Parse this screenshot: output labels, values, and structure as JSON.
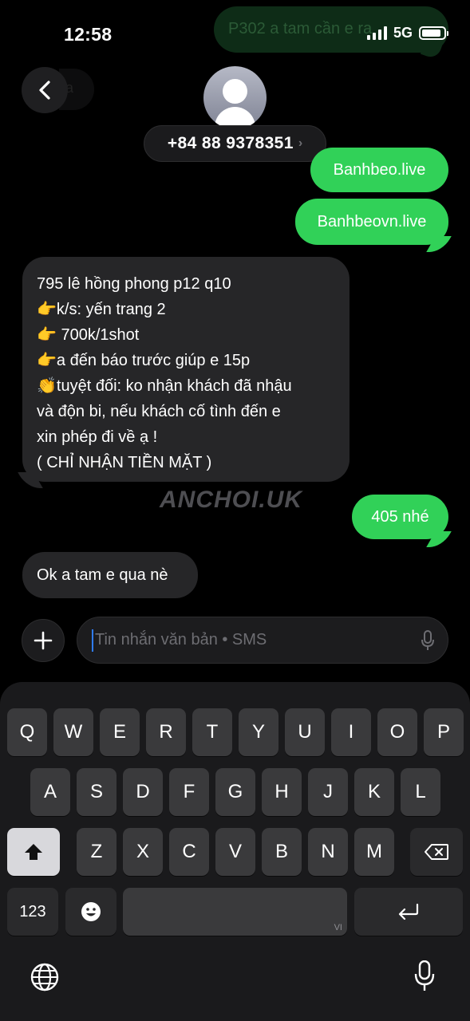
{
  "status": {
    "time": "12:58",
    "network": "5G"
  },
  "ghost_notification": {
    "text": "P302 a tam cần e ra"
  },
  "header": {
    "back_ghost_text": "a",
    "contact_number": "+84 88 9378351",
    "chevron": "›"
  },
  "messages": [
    {
      "direction": "outgoing",
      "text": "Banhbeo.live"
    },
    {
      "direction": "outgoing",
      "text": "Banhbeovn.live"
    },
    {
      "direction": "incoming",
      "lines": [
        "795 lê hồng phong p12 q10",
        "👉k/s: yến trang 2",
        "👉 700k/1shot",
        "👉a đến báo trước giúp e 15p",
        "👏tuyệt đối: ko nhận khách đã nhậu",
        "và độn bi, nếu khách cố tình đến e",
        "xin phép đi về ạ !",
        "( CHỈ NHẬN TIỀN MẶT )"
      ]
    },
    {
      "direction": "outgoing",
      "text": "405 nhé"
    },
    {
      "direction": "incoming",
      "text": "Ok a tam e qua nè"
    }
  ],
  "watermark": "ANCHOI.UK",
  "composer": {
    "placeholder": "Tin nhắn văn bản • SMS"
  },
  "keyboard": {
    "row1": [
      "Q",
      "W",
      "E",
      "R",
      "T",
      "Y",
      "U",
      "I",
      "O",
      "P"
    ],
    "row2": [
      "A",
      "S",
      "D",
      "F",
      "G",
      "H",
      "J",
      "K",
      "L"
    ],
    "row3": [
      "Z",
      "X",
      "C",
      "V",
      "B",
      "N",
      "M"
    ],
    "numbers_key": "123",
    "space_language": "VI"
  },
  "colors": {
    "outgoing_bubble": "#31d158",
    "incoming_bubble": "#262628",
    "caret": "#2f7cf6"
  },
  "icons": [
    "back-chevron-icon",
    "person-icon",
    "plus-icon",
    "microphone-icon",
    "shift-icon",
    "delete-icon",
    "emoji-icon",
    "return-icon",
    "globe-icon"
  ]
}
